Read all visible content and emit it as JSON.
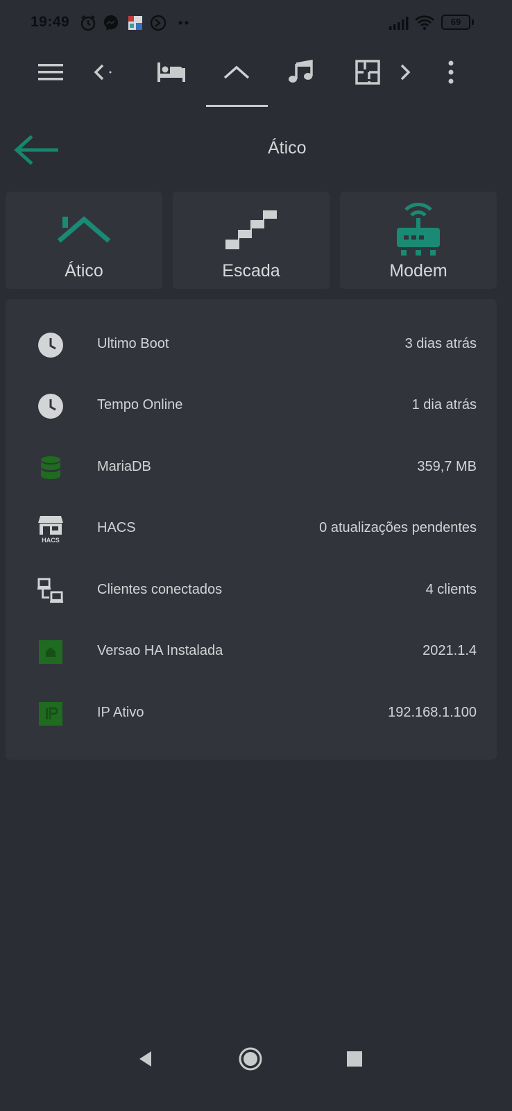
{
  "status_bar": {
    "time": "19:49",
    "battery": "69",
    "icons": [
      "alarm-icon",
      "messenger-icon",
      "app-icon",
      "sync-icon",
      "more-dots-icon",
      "signal-icon",
      "wifi-icon",
      "battery-icon"
    ]
  },
  "toolbar": {
    "icons": [
      "menu-icon",
      "chevron-left-icon",
      "bed-icon",
      "roof-icon",
      "music-icon",
      "floor-plan-icon",
      "chevron-right-icon",
      "overflow-menu-icon"
    ],
    "active_tab": "roof-icon"
  },
  "header": {
    "title": "Ático",
    "back_icon": "arrow-left-icon"
  },
  "tiles": [
    {
      "label": "Ático",
      "icon": "roof-icon"
    },
    {
      "label": "Escada",
      "icon": "stairs-icon"
    },
    {
      "label": "Modem",
      "icon": "router-wifi-icon"
    }
  ],
  "entities": [
    {
      "name": "Ultimo Boot",
      "value": "3 dias atrás",
      "icon": "clock-icon"
    },
    {
      "name": "Tempo Online",
      "value": "1 dia atrás",
      "icon": "clock-icon"
    },
    {
      "name": "MariaDB",
      "value": "359,7 MB",
      "icon": "database-icon"
    },
    {
      "name": "HACS",
      "value": "0 atualizações pendentes",
      "icon": "hacs-icon",
      "icon_text": "HACS"
    },
    {
      "name": "Clientes conectados",
      "value": "4 clients",
      "icon": "lan-icon"
    },
    {
      "name": "Versao HA Instalada",
      "value": "2021.1.4",
      "icon": "home-assistant-icon"
    },
    {
      "name": "IP Ativo",
      "value": "192.168.1.100",
      "icon": "ip-icon"
    }
  ],
  "colors": {
    "background": "#2a2d34",
    "card": "#31343b",
    "accent": "#1a8a74",
    "green": "#1f6b1f"
  }
}
